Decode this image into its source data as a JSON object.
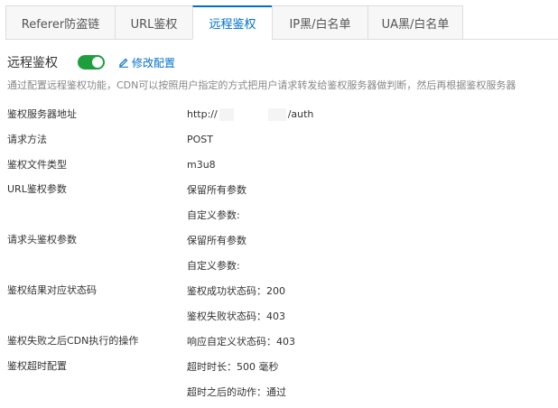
{
  "tabs": [
    {
      "label": "Referer防盗链",
      "active": false
    },
    {
      "label": "URL鉴权",
      "active": false
    },
    {
      "label": "远程鉴权",
      "active": true
    },
    {
      "label": "IP黑/白名单",
      "active": false
    },
    {
      "label": "UA黑/白名单",
      "active": false
    }
  ],
  "section": {
    "title": "远程鉴权",
    "toggle_on": true,
    "edit_label": "修改配置",
    "description": "通过配置远程鉴权功能，CDN可以按照用户指定的方式把用户请求转发给鉴权服务器做判断，然后再根据鉴权服务器"
  },
  "colors": {
    "accent": "#0070cc",
    "toggle": "#1e9e3c"
  },
  "config": {
    "server_label": "鉴权服务器地址",
    "server_prefix": "http://",
    "server_suffix": "/auth",
    "method_label": "请求方法",
    "method_value": "POST",
    "filetype_label": "鉴权文件类型",
    "filetype_value": "m3u8",
    "url_params_label": "URL鉴权参数",
    "url_params_keep": "保留所有参数",
    "url_params_custom": "自定义参数:",
    "header_params_label": "请求头鉴权参数",
    "header_params_keep": "保留所有参数",
    "header_params_custom": "自定义参数:",
    "status_label": "鉴权结果对应状态码",
    "status_success": "鉴权成功状态码：200",
    "status_fail": "鉴权失败状态码：403",
    "fail_action_label": "鉴权失败之后CDN执行的操作",
    "fail_action_value": "响应自定义状态码：403",
    "timeout_label": "鉴权超时配置",
    "timeout_duration": "超时时长：500 毫秒",
    "timeout_action": "超时之后的动作：通过"
  }
}
